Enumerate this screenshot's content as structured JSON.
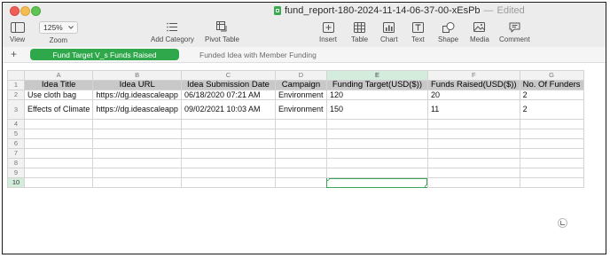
{
  "window": {
    "document_title": "fund_report-180-2024-11-14-06-37-00-xEsPb",
    "separator": "—",
    "edited": "Edited"
  },
  "toolbar": {
    "view": "View",
    "zoom_value": "125%",
    "zoom": "Zoom",
    "add_category": "Add Category",
    "pivot_table": "Pivot Table",
    "insert": "Insert",
    "table": "Table",
    "chart": "Chart",
    "text": "Text",
    "shape": "Shape",
    "media": "Media",
    "comment": "Comment"
  },
  "tabs": {
    "add": "+",
    "active": "Fund Target V_s Funds Raised",
    "inactive": "Funded Idea with Member Funding"
  },
  "grid": {
    "column_letters": [
      "A",
      "B",
      "C",
      "D",
      "E",
      "F",
      "G"
    ],
    "row_numbers": [
      "1",
      "2",
      "3",
      "4",
      "5",
      "6",
      "7",
      "8",
      "9",
      "10"
    ],
    "headers": [
      "Idea Title",
      "Idea URL",
      "Idea Submission Date",
      "Campaign",
      "Funding Target(USD($))",
      "Funds Raised(USD($))",
      "No. Of Funders"
    ],
    "rows": [
      [
        "Use cloth bag",
        "https://dg.ideascaleapp",
        "06/18/2020 07:21 AM",
        "Environment",
        "120",
        "20",
        "2"
      ],
      [
        "Effects of Climate",
        "https://dg.ideascaleapp",
        "09/02/2021 10:03 AM",
        "Environment",
        "150",
        "11",
        "2"
      ]
    ]
  },
  "colors": {
    "accent": "#2fa84b",
    "header_fill": "#c8c8c8",
    "selection": "#3aa55a"
  }
}
